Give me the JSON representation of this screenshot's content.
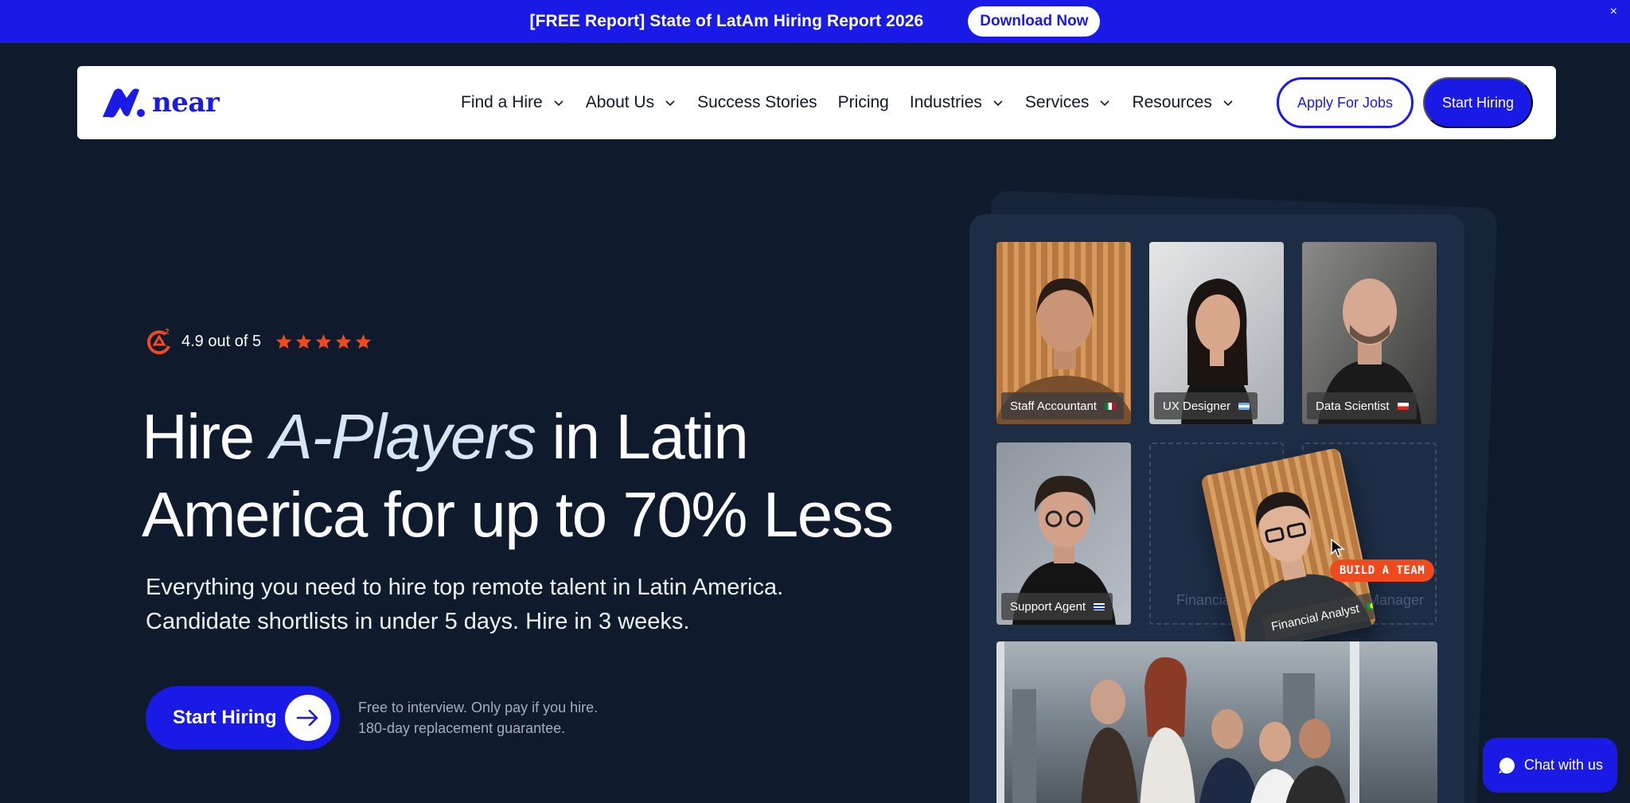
{
  "banner": {
    "text": "[FREE Report] State of LatAm Hiring Report 2026",
    "button_label": "Download Now",
    "close_label": "×"
  },
  "nav": {
    "logo_text": "near",
    "items": [
      {
        "label": "Find a Hire",
        "has_dropdown": true
      },
      {
        "label": "About Us",
        "has_dropdown": true
      },
      {
        "label": "Success Stories",
        "has_dropdown": false
      },
      {
        "label": "Pricing",
        "has_dropdown": false
      },
      {
        "label": "Industries",
        "has_dropdown": true
      },
      {
        "label": "Services",
        "has_dropdown": true
      },
      {
        "label": "Resources",
        "has_dropdown": true
      }
    ],
    "apply_label": "Apply For Jobs",
    "start_label": "Start Hiring"
  },
  "hero": {
    "rating_text": "4.9 out of 5",
    "stars": 5,
    "headline_pre": "Hire ",
    "headline_em": "A-Players",
    "headline_post": " in Latin America for up to 70% Less",
    "sub_line1": "Everything you need to hire top remote talent in Latin America.",
    "sub_line2": "Candidate shortlists in under 5 days. Hire in 3 weeks.",
    "cta_label": "Start Hiring",
    "note_line1": "Free to interview. Only pay if you hire.",
    "note_line2": "180-day replacement guarantee."
  },
  "panel": {
    "cards": [
      {
        "role": "Staff Accountant",
        "flag": "mexico"
      },
      {
        "role": "UX Designer",
        "flag": "argentina"
      },
      {
        "role": "Data Scientist",
        "flag": "chile"
      },
      {
        "role": "Support Agent",
        "flag": "uruguay"
      }
    ],
    "slot_left": "Financia",
    "slot_right": "Manager",
    "floating_role": "Financial Analyst",
    "floating_flag": "brazil",
    "badge": "BUILD A TEAM"
  },
  "chat": {
    "label": "Chat with us"
  },
  "colors": {
    "brand": "#1a1ae6",
    "background": "#0f1b2c",
    "accent": "#ef4a1e"
  }
}
